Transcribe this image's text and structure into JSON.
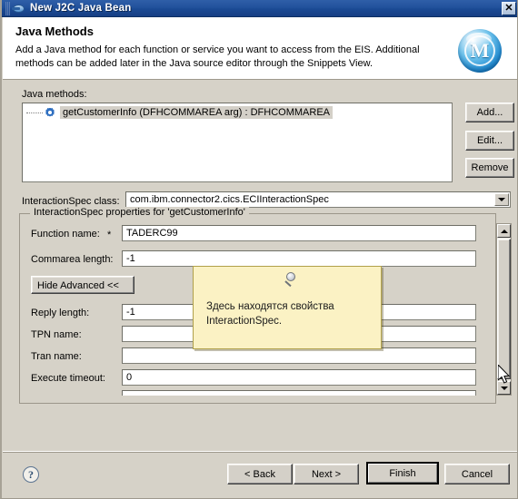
{
  "window": {
    "title": "New J2C Java Bean",
    "close_label": "✕",
    "icon": "java-bean-icon"
  },
  "header": {
    "title": "Java Methods",
    "description": "Add a Java method for each function or service you want to access from the EIS.  Additional methods can be added later in the Java source editor through the Snippets View.",
    "logo_letter": "M"
  },
  "methods": {
    "label": "Java methods:",
    "items": [
      {
        "text": "getCustomerInfo (DFHCOMMAREA arg) : DFHCOMMAREA",
        "selected": true
      }
    ],
    "buttons": {
      "add": "Add...",
      "edit": "Edit...",
      "remove": "Remove"
    }
  },
  "interaction_spec": {
    "class_label": "InteractionSpec class:",
    "class_value": "com.ibm.connector2.cics.ECIInteractionSpec",
    "group_legend": "InteractionSpec properties for 'getCustomerInfo'",
    "hide_advanced_label": "Hide Advanced <<",
    "required_marker": "*",
    "fields": [
      {
        "label": "Function name:",
        "value": "TADERC99",
        "required": true
      },
      {
        "label": "Commarea length:",
        "value": "-1",
        "required": false
      },
      {
        "label": "Reply length:",
        "value": "-1",
        "required": false
      },
      {
        "label": "TPN name:",
        "value": "",
        "required": false
      },
      {
        "label": "Tran name:",
        "value": "",
        "required": false
      },
      {
        "label": "Execute timeout:",
        "value": "0",
        "required": false
      }
    ]
  },
  "tooltip": {
    "text": "Здесь находятся свойства\nInteractionSpec.",
    "icon": "magnifier-icon",
    "background_color": "#fbf2c4",
    "border_color": "#b0a04a"
  },
  "footer": {
    "help_label": "?",
    "back": "< Back",
    "next": "Next >",
    "finish": "Finish",
    "cancel": "Cancel"
  },
  "colors": {
    "titlebar": "#22519c",
    "dialog_background": "#d6d2c8",
    "header_background": "#ffffff",
    "field_background": "#ffffff",
    "selection": "#d4d0c8"
  }
}
